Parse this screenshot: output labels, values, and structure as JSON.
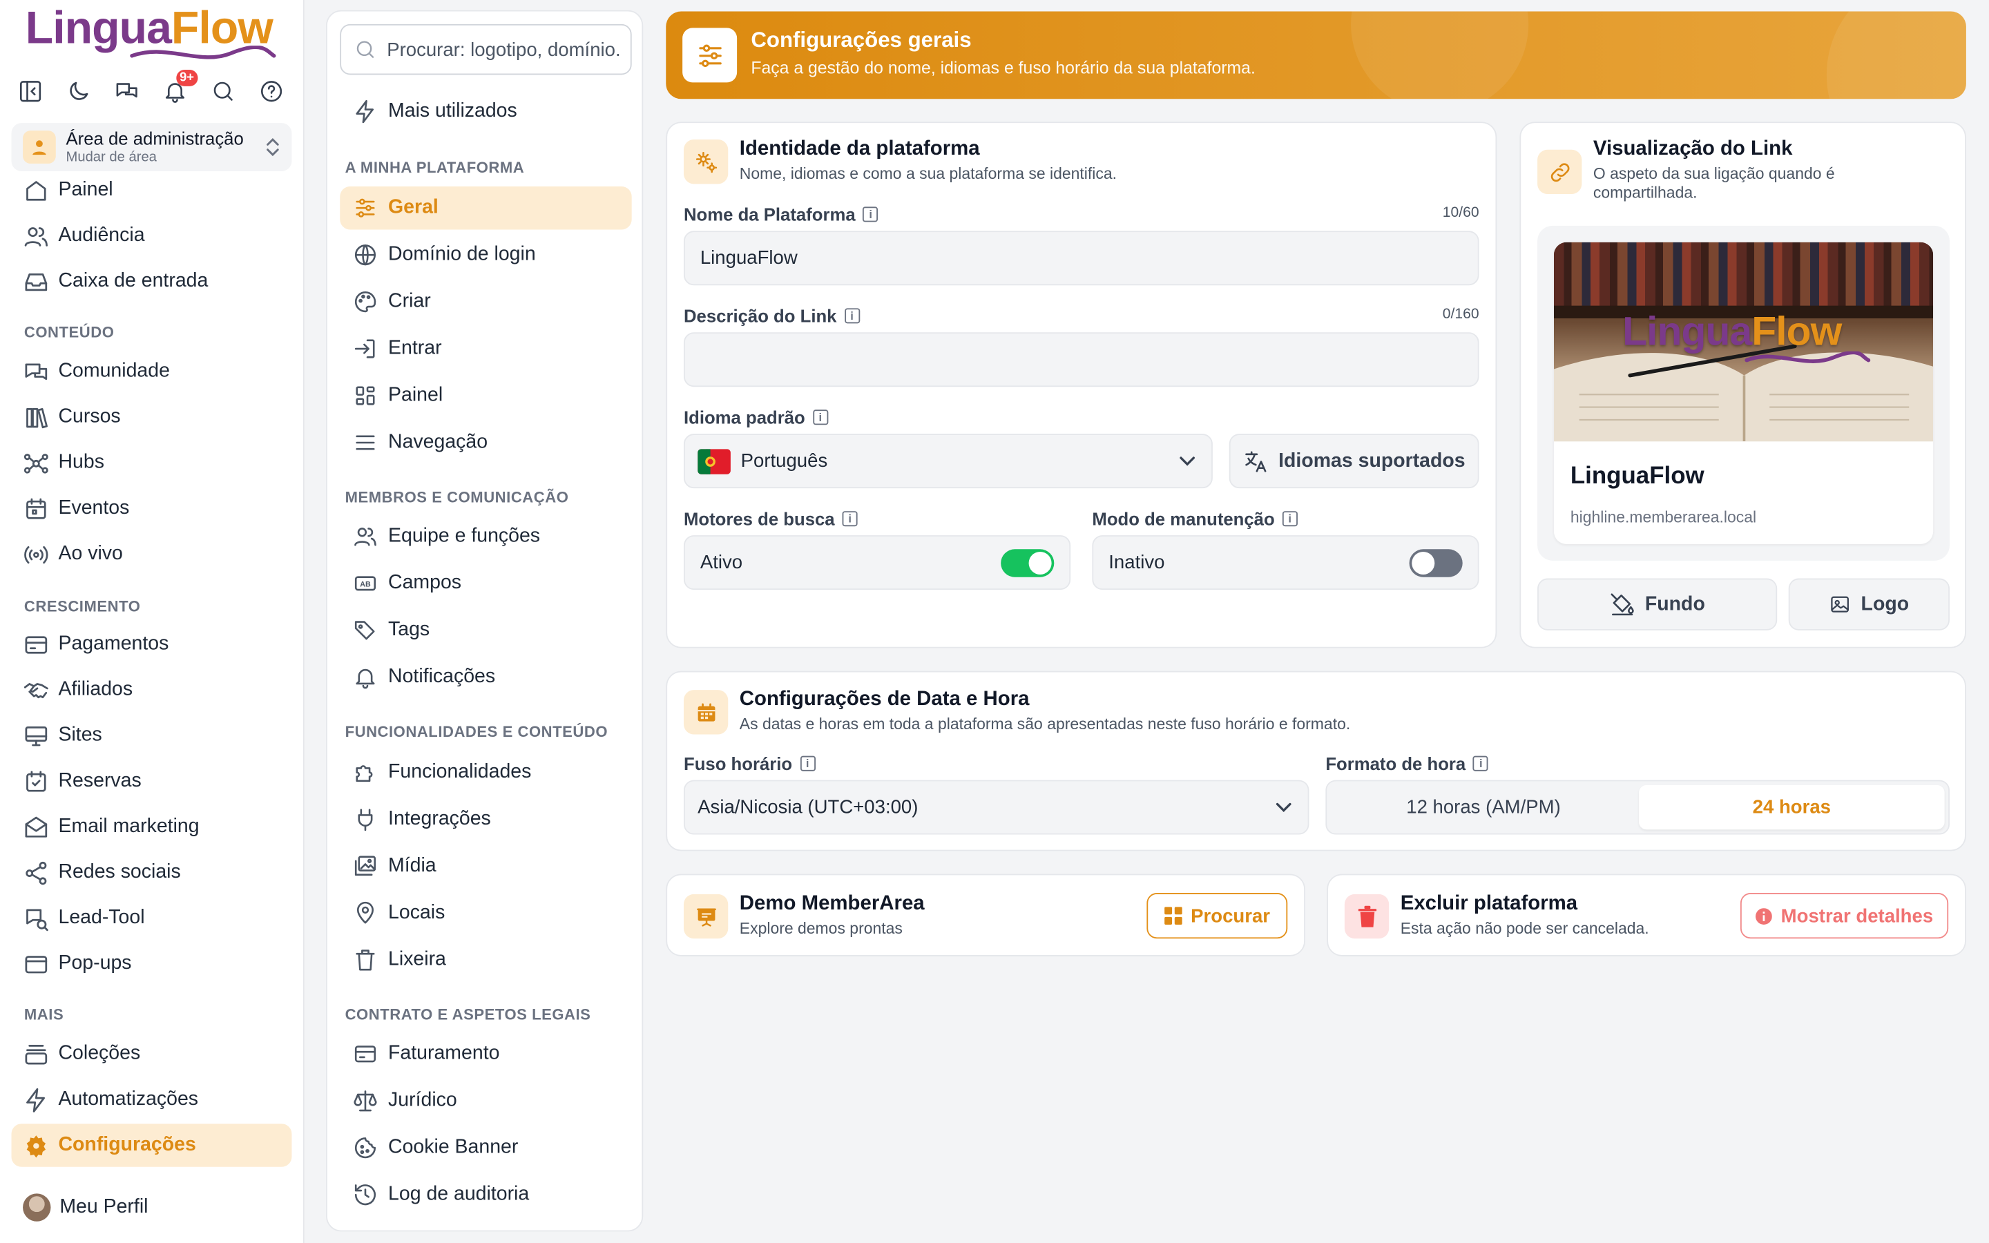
{
  "brand": {
    "part1": "Lingua",
    "part2": "Flow"
  },
  "header": {
    "notifications_badge": "9+"
  },
  "area": {
    "title": "Área de administração",
    "subtitle": "Mudar de área"
  },
  "sidebar": {
    "top_items": [
      {
        "label": "Painel",
        "icon": "home-icon"
      },
      {
        "label": "Audiência",
        "icon": "users-icon"
      },
      {
        "label": "Caixa de entrada",
        "icon": "inbox-icon"
      }
    ],
    "sections": [
      "CONTEÚDO",
      "CRESCIMENTO",
      "MAIS"
    ],
    "content_items": [
      "Comunidade",
      "Cursos",
      "Hubs",
      "Eventos",
      "Ao vivo"
    ],
    "growth_items": [
      "Pagamentos",
      "Afiliados",
      "Sites",
      "Reservas",
      "Email marketing",
      "Redes sociais",
      "Lead-Tool",
      "Pop-ups"
    ],
    "more_items": [
      "Coleções",
      "Automatizações",
      "Configurações"
    ],
    "profile": "Meu Perfil"
  },
  "settings_nav": {
    "search_placeholder": "Procurar: logotipo, domínio...",
    "most_used": "Mais utilizados",
    "sections": [
      "A MINHA PLATAFORMA",
      "MEMBROS E COMUNICAÇÃO",
      "FUNCIONALIDADES E CONTEÚDO",
      "CONTRATO E ASPETOS LEGAIS"
    ],
    "platform": [
      "Geral",
      "Domínio de login",
      "Criar",
      "Entrar",
      "Painel",
      "Navegação"
    ],
    "members": [
      "Equipe e funções",
      "Campos",
      "Tags",
      "Notificações"
    ],
    "features": [
      "Funcionalidades",
      "Integrações",
      "Mídia",
      "Locais",
      "Lixeira"
    ],
    "legal": [
      "Faturamento",
      "Jurídico",
      "Cookie Banner",
      "Log de auditoria"
    ]
  },
  "banner": {
    "title": "Configurações gerais",
    "subtitle": "Faça a gestão do nome, idiomas e fuso horário da sua plataforma."
  },
  "identity": {
    "title": "Identidade da plataforma",
    "subtitle": "Nome, idiomas e como a sua plataforma se identifica.",
    "name_label": "Nome da Plataforma",
    "name_counter": "10/60",
    "name_value": "LinguaFlow",
    "desc_label": "Descrição do Link",
    "desc_counter": "0/160",
    "desc_value": "",
    "lang_label": "Idioma padrão",
    "lang_value": "Português",
    "supported_btn": "Idiomas suportados",
    "search_label": "Motores de busca",
    "search_value": "Ativo",
    "search_on": true,
    "maint_label": "Modo de manutenção",
    "maint_value": "Inativo",
    "maint_on": false
  },
  "preview": {
    "title": "Visualização do Link",
    "subtitle": "O aspeto da sua ligação quando é compartilhada.",
    "name": "LinguaFlow",
    "url": "highline.memberarea.local",
    "bg_btn": "Fundo",
    "logo_btn": "Logo"
  },
  "datetime": {
    "title": "Configurações de Data e Hora",
    "subtitle": "As datas e horas em toda a plataforma são apresentadas neste fuso horário e formato.",
    "tz_label": "Fuso horário",
    "tz_value": "Asia/Nicosia (UTC+03:00)",
    "fmt_label": "Formato de hora",
    "fmt_12": "12 horas (AM/PM)",
    "fmt_24": "24 horas",
    "selected_format": "24 horas"
  },
  "demo": {
    "title": "Demo MemberArea",
    "subtitle": "Explore demos prontas",
    "button": "Procurar"
  },
  "delete": {
    "title": "Excluir plataforma",
    "subtitle": "Esta ação não pode ser cancelada.",
    "button": "Mostrar detalhes"
  },
  "colors": {
    "accent": "#dd8a13",
    "brand_purple": "#7b3a8a",
    "toggle_on": "#16c25e",
    "danger": "#ef4444"
  }
}
